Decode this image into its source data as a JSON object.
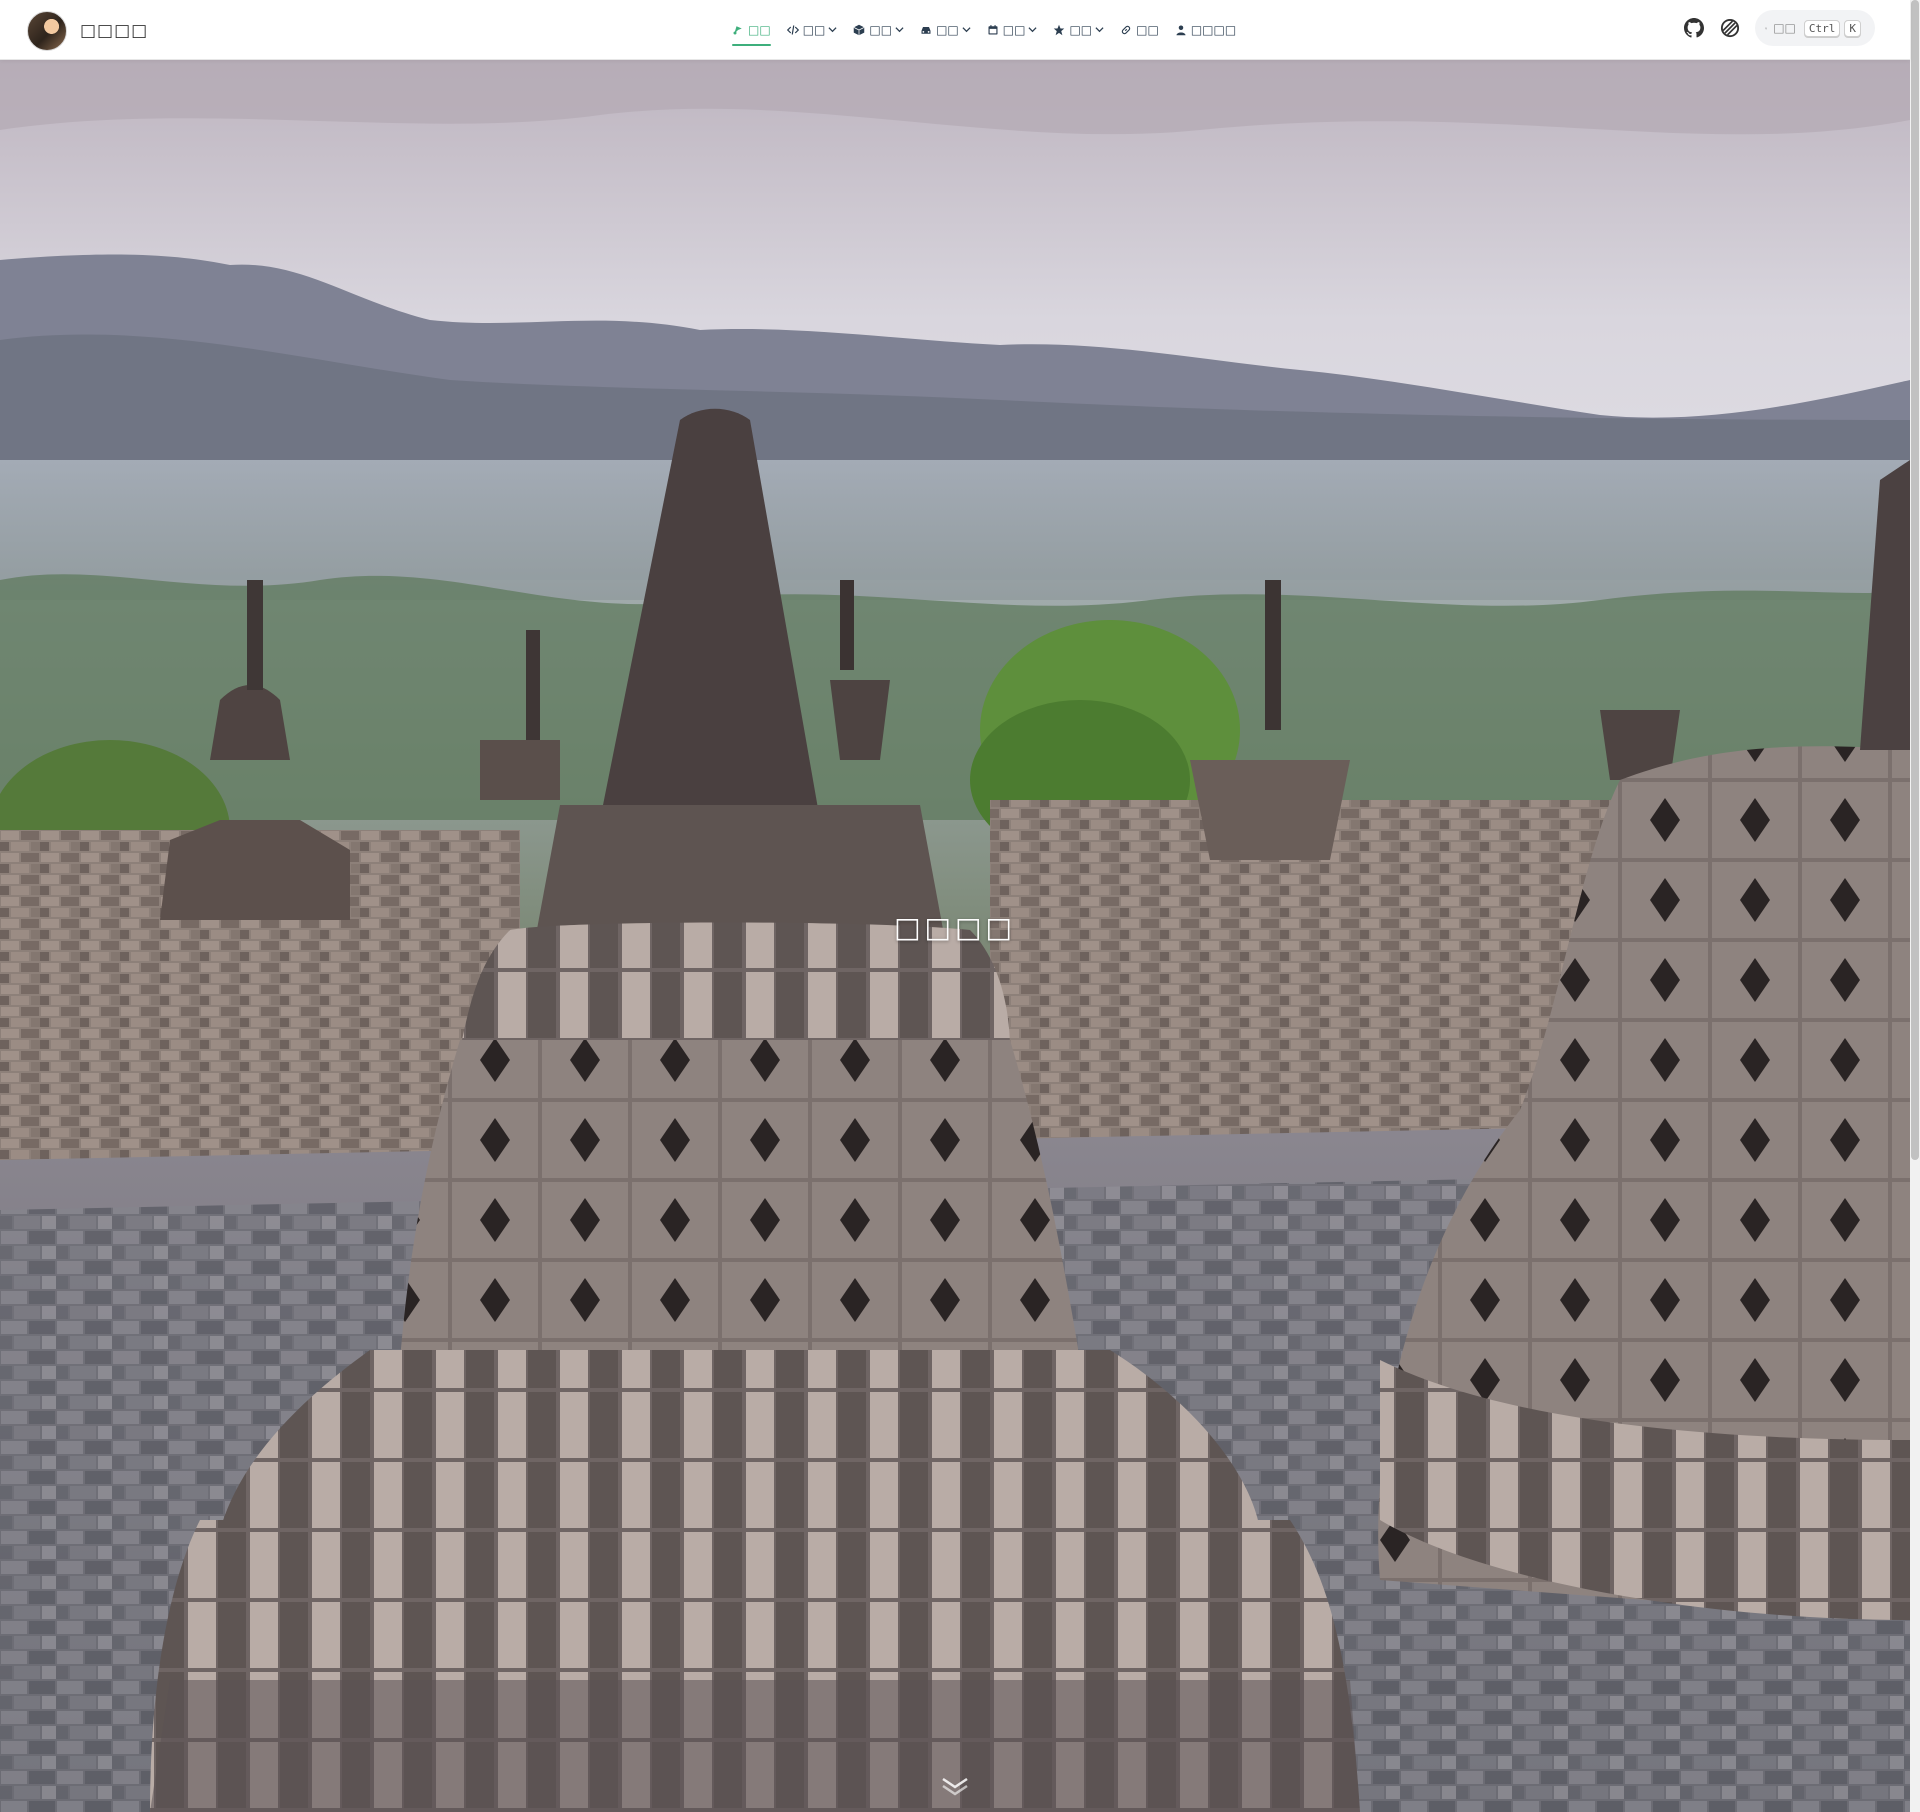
{
  "site": {
    "name": "□□□□"
  },
  "nav": {
    "items": [
      {
        "label": "□□",
        "icon": "compass-icon",
        "active": true,
        "dropdown": false
      },
      {
        "label": "□□",
        "icon": "code-icon",
        "active": false,
        "dropdown": true
      },
      {
        "label": "□□",
        "icon": "cube-icon",
        "active": false,
        "dropdown": true
      },
      {
        "label": "□□",
        "icon": "car-icon",
        "active": false,
        "dropdown": true
      },
      {
        "label": "□□",
        "icon": "calendar-icon",
        "active": false,
        "dropdown": true
      },
      {
        "label": "□□",
        "icon": "star-icon",
        "active": false,
        "dropdown": true
      },
      {
        "label": "□□",
        "icon": "link-icon",
        "active": false,
        "dropdown": false
      },
      {
        "label": "□□□□",
        "icon": "user-icon",
        "active": false,
        "dropdown": false
      }
    ]
  },
  "tools": {
    "github_icon": "github-icon",
    "theme_icon": "theme-toggle-icon"
  },
  "search": {
    "placeholder": "□□",
    "kbd1": "Ctrl",
    "kbd2": "K"
  },
  "hero": {
    "title": "□□□□",
    "scroll_icon": "chevron-down-icon"
  },
  "colors": {
    "accent": "#3eaf7c",
    "navbar_bg": "#ffffff",
    "text": "#2c3e50"
  }
}
